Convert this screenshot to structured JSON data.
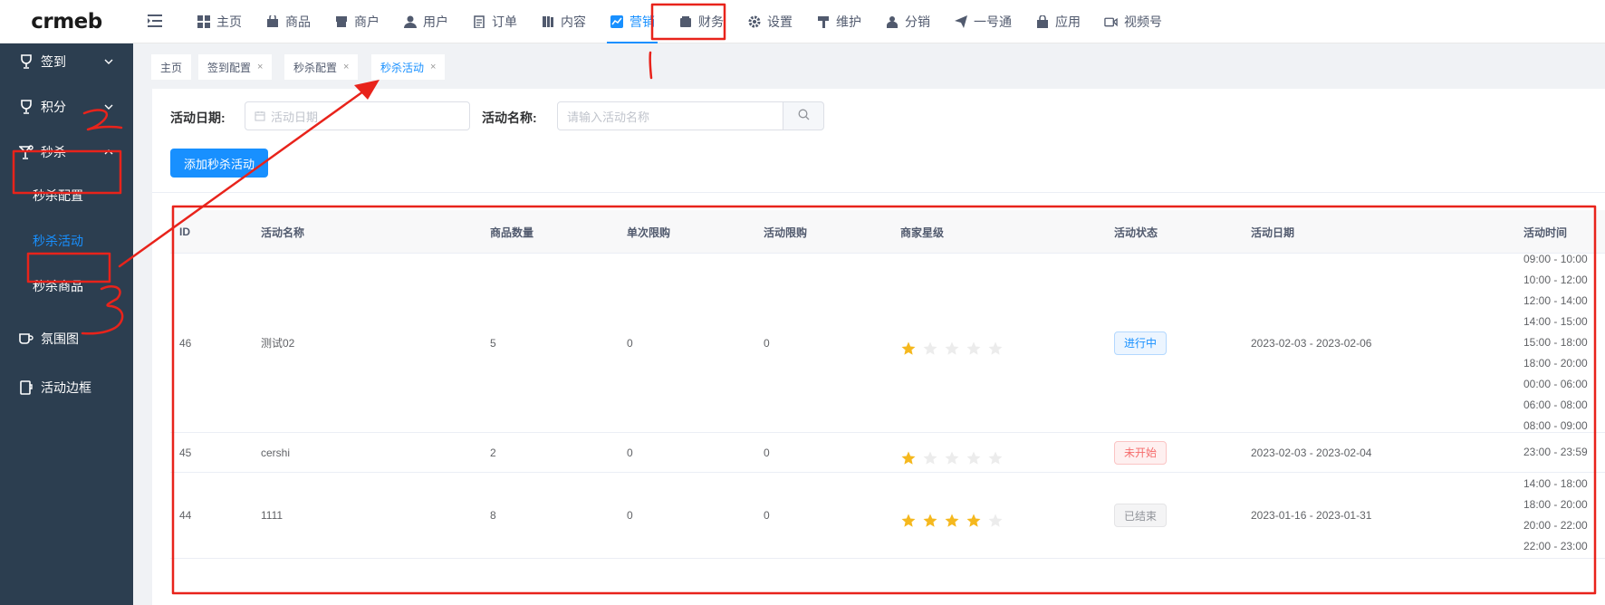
{
  "header": {
    "logo": "crmeb",
    "nav": [
      {
        "label": "主页",
        "icon": "grid-icon"
      },
      {
        "label": "商品",
        "icon": "bag-icon"
      },
      {
        "label": "商户",
        "icon": "shop-icon"
      },
      {
        "label": "用户",
        "icon": "user-icon"
      },
      {
        "label": "订单",
        "icon": "clipboard-icon"
      },
      {
        "label": "内容",
        "icon": "book-icon"
      },
      {
        "label": "营销",
        "icon": "chart-icon",
        "active": true
      },
      {
        "label": "财务",
        "icon": "wallet-icon"
      },
      {
        "label": "设置",
        "icon": "gear-icon"
      },
      {
        "label": "维护",
        "icon": "hammer-icon"
      },
      {
        "label": "分销",
        "icon": "person-icon"
      },
      {
        "label": "一号通",
        "icon": "send-icon"
      },
      {
        "label": "应用",
        "icon": "lock-bag-icon"
      },
      {
        "label": "视频号",
        "icon": "video-icon"
      }
    ]
  },
  "sidebar": {
    "items": [
      {
        "label": "签到",
        "icon": "cup-icon"
      },
      {
        "label": "积分",
        "icon": "cup-icon"
      },
      {
        "label": "秒杀",
        "icon": "cocktail-icon"
      }
    ],
    "sub_items": [
      {
        "label": "秒杀配置"
      },
      {
        "label": "秒杀活动",
        "active": true
      },
      {
        "label": "秒杀商品"
      }
    ],
    "more_items": [
      {
        "label": "氛围图",
        "icon": "mug-icon"
      },
      {
        "label": "活动边框",
        "icon": "frame-icon"
      }
    ]
  },
  "tags": [
    {
      "label": "主页"
    },
    {
      "label": "签到配置"
    },
    {
      "label": "秒杀配置"
    },
    {
      "label": "秒杀活动",
      "active": true
    }
  ],
  "filters": {
    "date_label": "活动日期:",
    "date_placeholder": "活动日期",
    "name_label": "活动名称:",
    "name_placeholder": "请输入活动名称",
    "add_button": "添加秒杀活动"
  },
  "table": {
    "columns": [
      "ID",
      "活动名称",
      "商品数量",
      "单次限购",
      "活动限购",
      "商家星级",
      "活动状态",
      "活动日期",
      "活动时间"
    ],
    "rows": [
      {
        "id": "46",
        "name": "测试02",
        "count": "5",
        "single_limit": "0",
        "total_limit": "0",
        "stars": 1,
        "status": "进行中",
        "status_color": "blue",
        "date": "2023-02-03 - 2023-02-06",
        "times": [
          "09:00 - 10:00",
          "10:00 - 12:00",
          "12:00 - 14:00",
          "14:00 - 15:00",
          "15:00 - 18:00",
          "18:00 - 20:00",
          "00:00 - 06:00",
          "06:00 - 08:00",
          "08:00 - 09:00"
        ]
      },
      {
        "id": "45",
        "name": "cershi",
        "count": "2",
        "single_limit": "0",
        "total_limit": "0",
        "stars": 1,
        "status": "未开始",
        "status_color": "red",
        "date": "2023-02-03 - 2023-02-04",
        "times": [
          "23:00 - 23:59"
        ]
      },
      {
        "id": "44",
        "name": "1111",
        "count": "8",
        "single_limit": "0",
        "total_limit": "0",
        "stars": 4,
        "status": "已结束",
        "status_color": "gray",
        "date": "2023-01-16 - 2023-01-31",
        "times": [
          "14:00 - 18:00",
          "18:00 - 20:00",
          "20:00 - 22:00",
          "22:00 - 23:00"
        ]
      }
    ]
  },
  "colors": {
    "primary": "#1890ff",
    "sidebar": "#2c3e50",
    "star": "#f5b81e",
    "annotation": "#e8231b"
  }
}
